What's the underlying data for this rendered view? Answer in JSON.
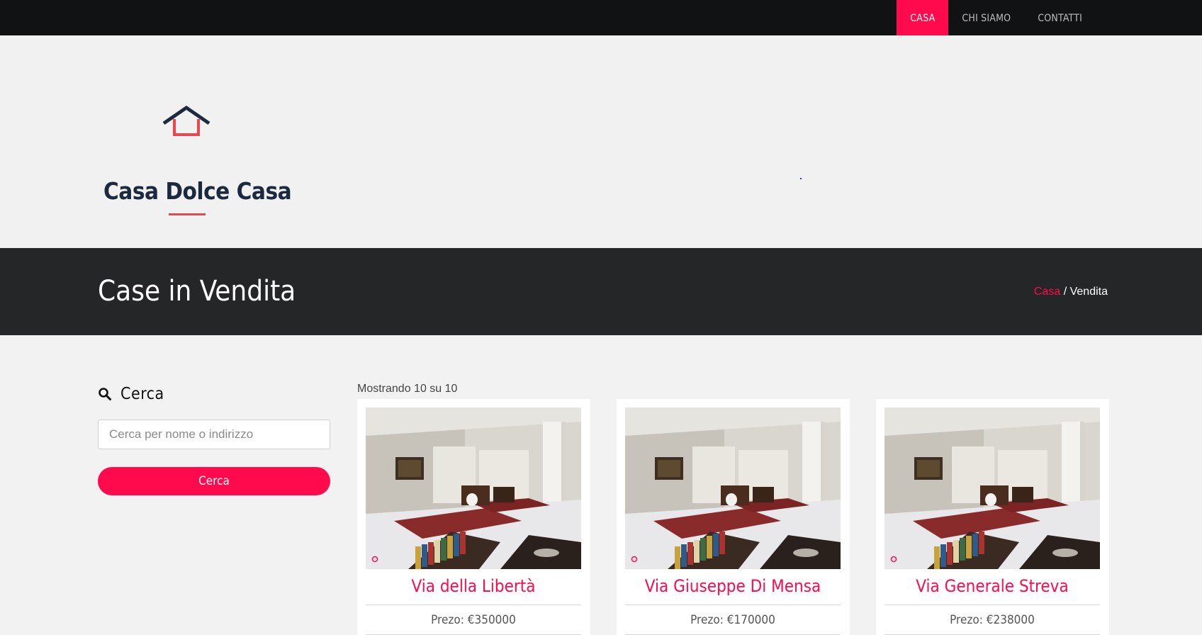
{
  "nav": {
    "items": [
      {
        "label": "CASA",
        "active": true
      },
      {
        "label": "CHI SIAMO",
        "active": false
      },
      {
        "label": "CONTATTI",
        "active": false
      }
    ]
  },
  "logo": {
    "text": "Casa Dolce Casa"
  },
  "band": {
    "title": "Case in Vendita"
  },
  "breadcrumb": {
    "home": "Casa",
    "separator": " / ",
    "current": "Vendita"
  },
  "search": {
    "title": "Cerca",
    "placeholder": "Cerca per nome o indirizzo",
    "button_label": "Cerca"
  },
  "results": {
    "count_text": "Mostrando 10 su 10",
    "cards": [
      {
        "title": "Via della Libertà",
        "price": "Prezo: €350000"
      },
      {
        "title": "Via Giuseppe Di Mensa",
        "price": "Prezo: €170000"
      },
      {
        "title": "Via Generale Streva",
        "price": "Prezo: €238000"
      }
    ]
  },
  "colors": {
    "accent": "#ff0a4d",
    "topbar": "#111213",
    "band": "#252627",
    "logo_navy": "#1c2a3f",
    "logo_red": "#e8484d"
  }
}
